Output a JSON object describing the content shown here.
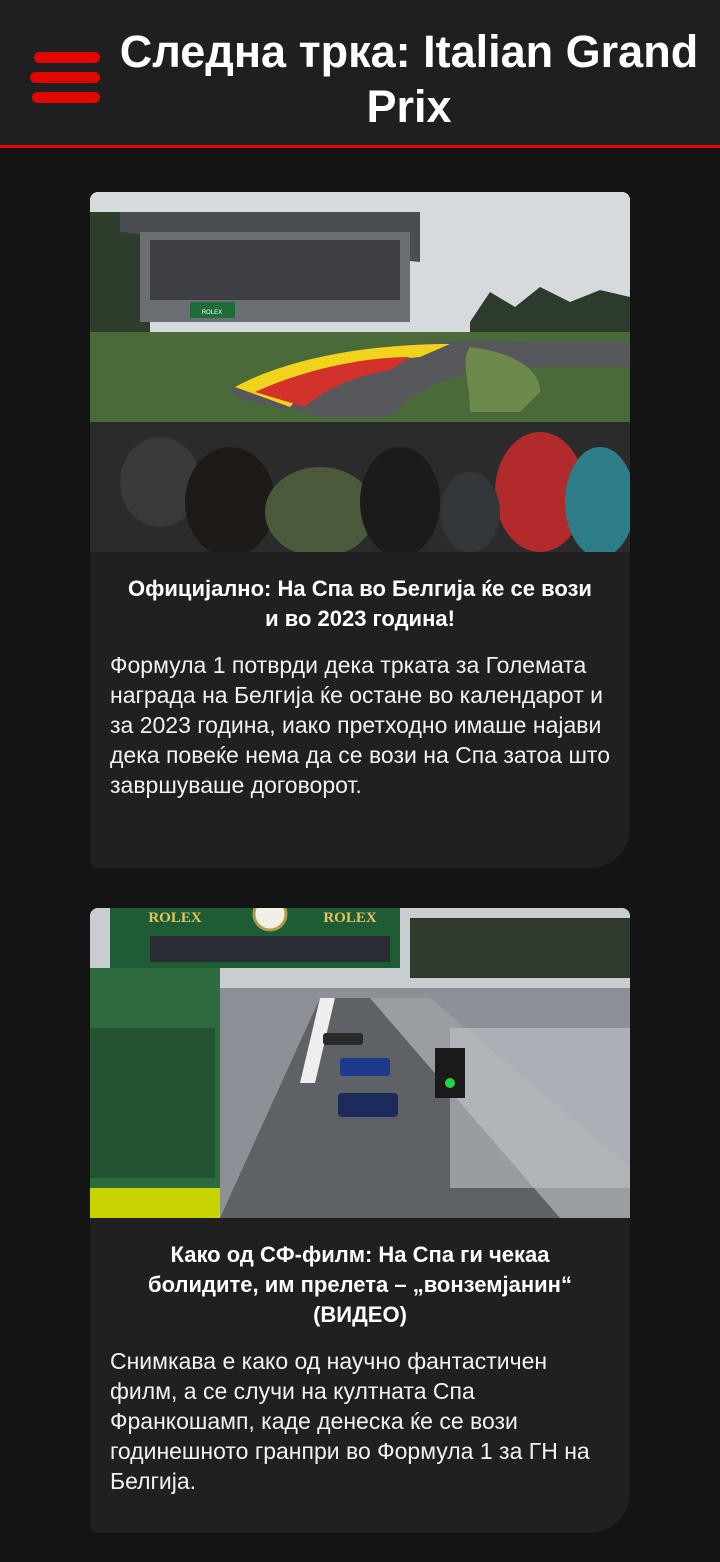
{
  "header": {
    "title": "Следна трка: Italian Grand Prix",
    "menu_icon": "hamburger-menu-icon",
    "accent_color": "#e10600"
  },
  "articles": [
    {
      "title": "Официјално: На Спа во Белгија ќе се вози и во 2023 година!",
      "summary": "Формула 1 потврди дека трката за Големата награда на Белгија ќе остане во календарот и за 2023 година, иако претходно имаше најави дека повеќе нема да се вози на Спа затоа што завршуваше договорот.",
      "image_signs": {
        "rolex": "ROLEX"
      }
    },
    {
      "title": "Како од СФ-филм: На Спа ги чекаа болидите, им прелета – „вонземјанин“ (ВИДЕО)",
      "summary": "Снимкава е како од научно фантастичен филм, а се случи на култната Спа Франкошамп, каде денеска ќе се вози годинешното гранпри во Формула 1 за ГН на Белгија.",
      "image_signs": {
        "rolex_left": "ROLEX",
        "rolex_right": "ROLEX"
      }
    }
  ]
}
